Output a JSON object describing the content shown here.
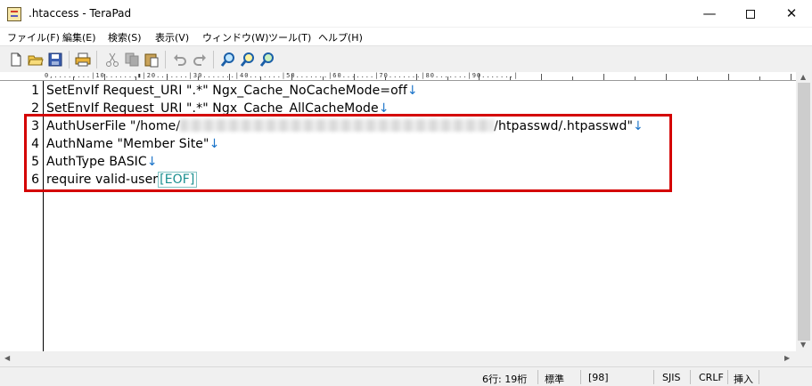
{
  "window": {
    "title": ".htaccess - TeraPad",
    "controls": {
      "minimize": "—",
      "close": "✕"
    }
  },
  "menu": [
    "ファイル(F)",
    "編集(E)",
    "検索(S)",
    "表示(V)",
    "ウィンドウ(W)",
    "ツール(T)",
    "ヘルプ(H)"
  ],
  "toolbar": {
    "icons": [
      "new-file-icon",
      "open-folder-icon",
      "save-icon",
      "print-icon",
      "cut-icon",
      "copy-icon",
      "paste-icon",
      "undo-icon",
      "redo-icon",
      "find-icon",
      "find-next-icon",
      "find-prev-icon"
    ]
  },
  "ruler": {
    "text": "0,........|10.......▮|20.......|30.......|40.......|50.......|60.......|70.......|80.......|90.......|"
  },
  "editor": {
    "lines": [
      {
        "num": "1",
        "text": "SetEnvIf Request_URI \".*\" Ngx_Cache_NoCacheMode=off",
        "eol": "↓"
      },
      {
        "num": "2",
        "text": "SetEnvIf Request_URI \".*\" Ngx_Cache_AllCacheMode",
        "eol": "↓"
      },
      {
        "num": "3",
        "text_before": "AuthUserFile \"/home/",
        "text_after": "/htpasswd/.htpasswd\"",
        "eol": "↓"
      },
      {
        "num": "4",
        "text": "AuthName \"Member Site\"",
        "eol": "↓"
      },
      {
        "num": "5",
        "text": "AuthType BASIC",
        "eol": "↓"
      },
      {
        "num": "6",
        "text": "require valid-user",
        "eol": "[EOF]"
      }
    ]
  },
  "statusbar": {
    "position": "6行:  19桁",
    "mode": "標準",
    "code": "[98]",
    "encoding": "SJIS",
    "line_ending": "CRLF",
    "insert_mode": "挿入"
  },
  "colors": {
    "highlight_border": "#d40000",
    "newline_mark": "#1a73c9",
    "eof_mark": "#1a8f8f"
  }
}
